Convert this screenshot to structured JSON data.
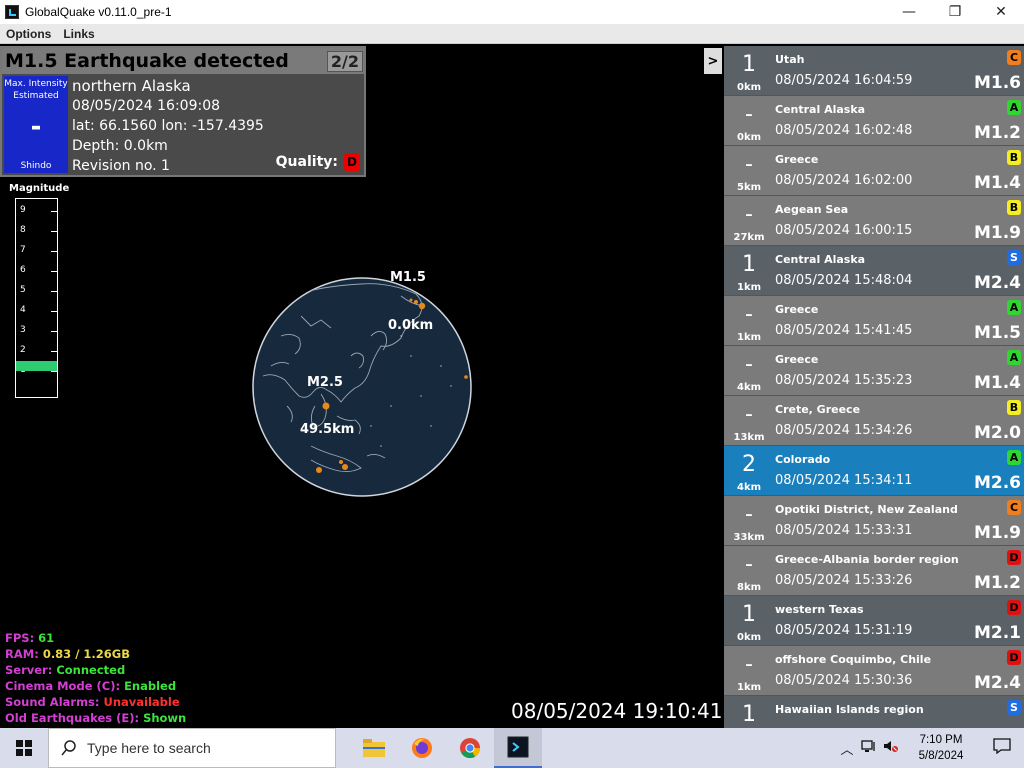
{
  "window": {
    "title": "GlobalQuake v0.11.0_pre-1",
    "minimize": "—",
    "maximize": "❐",
    "close": "✕"
  },
  "menu": [
    "Options",
    "Links"
  ],
  "detail": {
    "header": "M1.5 Earthquake detected",
    "count": "2/2",
    "shindo_top1": "Max. Intensity",
    "shindo_top2": "Estimated",
    "shindo_value": "-",
    "shindo_bottom": "Shindo",
    "location": "northern Alaska",
    "datetime": "08/05/2024 16:09:08",
    "coords": "lat: 66.1560 lon: -157.4395",
    "depth": "Depth: 0.0km",
    "revision": "Revision no. 1",
    "quality_label": "Quality:",
    "quality_grade": "D"
  },
  "magnitude_meter": {
    "label": "Magnitude",
    "ticks": [
      "9",
      "8",
      "7",
      "6",
      "5",
      "4",
      "3",
      "2",
      "1"
    ],
    "value": 1.5
  },
  "globe_labels": {
    "quake1_mag": "M1.5",
    "quake1_depth": "0.0km",
    "quake2_mag": "M2.5",
    "quake2_depth": "49.5km"
  },
  "stats": {
    "fps_label": "FPS: ",
    "fps_value": "61",
    "ram_label": "RAM: ",
    "ram_value": "0.83 / 1.26GB",
    "server_label": "Server: ",
    "server_value": "Connected",
    "cinema_label": "Cinema Mode (C): ",
    "cinema_value": "Enabled",
    "sound_label": "Sound Alarms: ",
    "sound_value": "Unavailable",
    "old_label": "Old Earthquakes (E): ",
    "old_value": "Shown"
  },
  "clock": "08/05/2024 19:10:41",
  "toggle": ">",
  "quakes": [
    {
      "intensity": "1",
      "depth": "0km",
      "location": "Utah",
      "time": "08/05/2024 16:04:59",
      "mag": "M1.6",
      "grade": "C",
      "grade_color": "#f07d1e",
      "style": "dark"
    },
    {
      "intensity": "-",
      "depth": "0km",
      "location": "Central Alaska",
      "time": "08/05/2024 16:02:48",
      "mag": "M1.2",
      "grade": "A",
      "grade_color": "#2fd62f",
      "style": ""
    },
    {
      "intensity": "-",
      "depth": "5km",
      "location": "Greece",
      "time": "08/05/2024 16:02:00",
      "mag": "M1.4",
      "grade": "B",
      "grade_color": "#f4ee22",
      "style": ""
    },
    {
      "intensity": "-",
      "depth": "27km",
      "location": "Aegean Sea",
      "time": "08/05/2024 16:00:15",
      "mag": "M1.9",
      "grade": "B",
      "grade_color": "#f4ee22",
      "style": ""
    },
    {
      "intensity": "1",
      "depth": "1km",
      "location": "Central Alaska",
      "time": "08/05/2024 15:48:04",
      "mag": "M2.4",
      "grade": "S",
      "grade_color": "#1f6de0",
      "style": "dark"
    },
    {
      "intensity": "-",
      "depth": "1km",
      "location": "Greece",
      "time": "08/05/2024 15:41:45",
      "mag": "M1.5",
      "grade": "A",
      "grade_color": "#2fd62f",
      "style": ""
    },
    {
      "intensity": "-",
      "depth": "4km",
      "location": "Greece",
      "time": "08/05/2024 15:35:23",
      "mag": "M1.4",
      "grade": "A",
      "grade_color": "#2fd62f",
      "style": ""
    },
    {
      "intensity": "-",
      "depth": "13km",
      "location": "Crete, Greece",
      "time": "08/05/2024 15:34:26",
      "mag": "M2.0",
      "grade": "B",
      "grade_color": "#f4ee22",
      "style": ""
    },
    {
      "intensity": "2",
      "depth": "4km",
      "location": "Colorado",
      "time": "08/05/2024 15:34:11",
      "mag": "M2.6",
      "grade": "A",
      "grade_color": "#2fd62f",
      "style": "selected"
    },
    {
      "intensity": "-",
      "depth": "33km",
      "location": "Opotiki District, New Zealand",
      "time": "08/05/2024 15:33:31",
      "mag": "M1.9",
      "grade": "C",
      "grade_color": "#f07d1e",
      "style": ""
    },
    {
      "intensity": "-",
      "depth": "8km",
      "location": "Greece-Albania border region",
      "time": "08/05/2024 15:33:26",
      "mag": "M1.2",
      "grade": "D",
      "grade_color": "#e01010",
      "style": ""
    },
    {
      "intensity": "1",
      "depth": "0km",
      "location": "western Texas",
      "time": "08/05/2024 15:31:19",
      "mag": "M2.1",
      "grade": "D",
      "grade_color": "#e01010",
      "style": "dark"
    },
    {
      "intensity": "-",
      "depth": "1km",
      "location": "offshore Coquimbo, Chile",
      "time": "08/05/2024 15:30:36",
      "mag": "M2.4",
      "grade": "D",
      "grade_color": "#e01010",
      "style": ""
    },
    {
      "intensity": "1",
      "depth": "",
      "location": "Hawaiian Islands region",
      "time": "",
      "mag": "",
      "grade": "S",
      "grade_color": "#1f6de0",
      "style": "dark"
    }
  ],
  "taskbar": {
    "search_placeholder": "Type here to search",
    "time": "7:10 PM",
    "date": "5/8/2024",
    "apps": [
      "file-explorer",
      "firefox",
      "chrome",
      "globalquake"
    ]
  }
}
